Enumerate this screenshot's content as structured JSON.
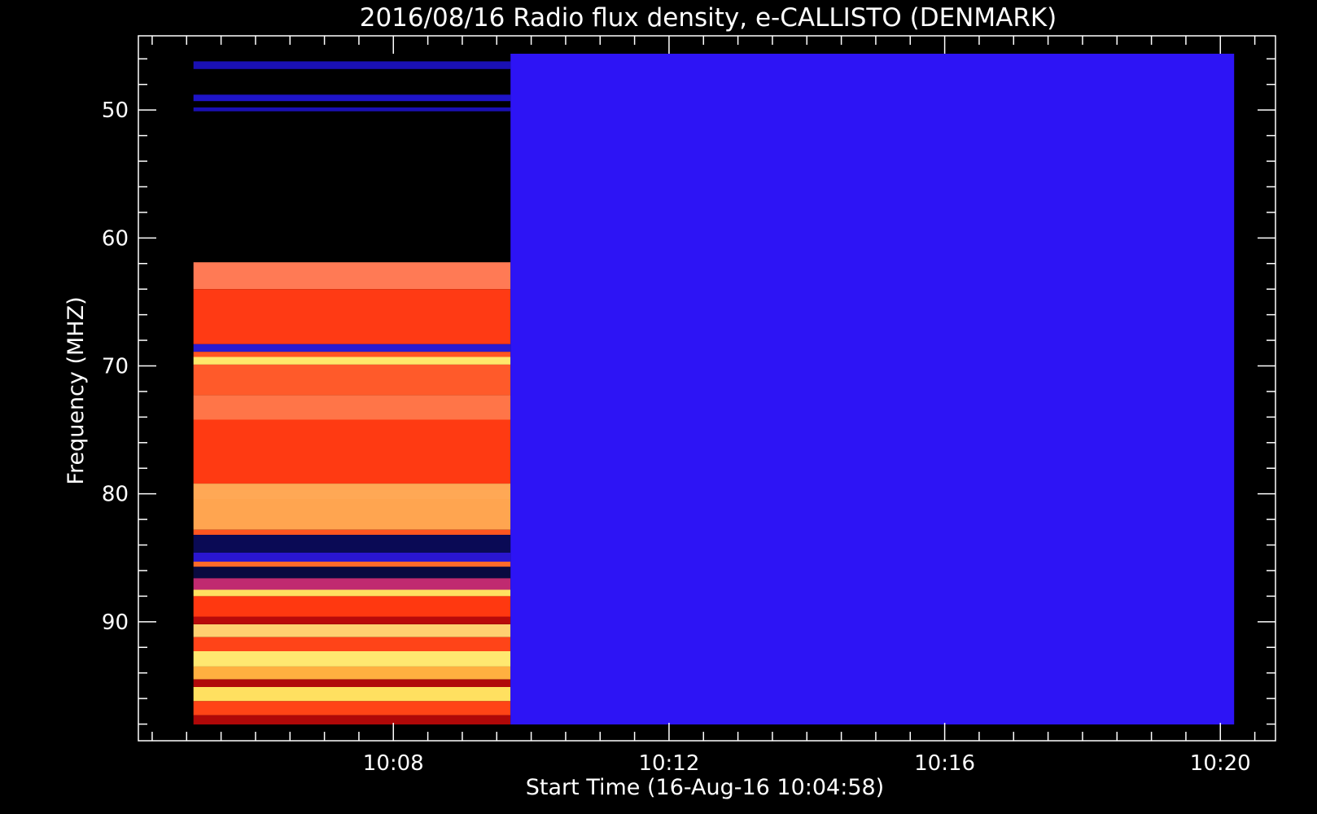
{
  "chart_data": {
    "type": "heatmap",
    "title": "2016/08/16  Radio flux density, e-CALLISTO (DENMARK)",
    "xlabel": "Start Time (16-Aug-16 10:04:58)",
    "ylabel": "Frequency (MHZ)",
    "x_unit": "minutes of day",
    "xlim": [
      604.3,
      620.8
    ],
    "ylim": [
      99.3,
      44.2
    ],
    "y_inverted": true,
    "x_ticks": [
      {
        "value": 608,
        "label": "10:08"
      },
      {
        "value": 612,
        "label": "10:12"
      },
      {
        "value": 616,
        "label": "10:16"
      },
      {
        "value": 620,
        "label": "10:20"
      }
    ],
    "y_ticks": [
      {
        "value": 50,
        "label": "50"
      },
      {
        "value": 60,
        "label": "60"
      },
      {
        "value": 70,
        "label": "70"
      },
      {
        "value": 80,
        "label": "80"
      },
      {
        "value": 90,
        "label": "90"
      }
    ],
    "x_minor_step": 0.5,
    "y_minor_step": 2,
    "segments": [
      {
        "x_range": [
          605.1,
          609.7
        ],
        "freq_range": [
          45.6,
          98.9
        ],
        "bands": [
          {
            "f": [
              46.2,
              46.8
            ],
            "color": "#1a10b4"
          },
          {
            "f": [
              48.8,
              49.3
            ],
            "color": "#1e14c8"
          },
          {
            "f": [
              49.8,
              50.1
            ],
            "color": "#1a10b4"
          },
          {
            "f": [
              61.9,
              64.0
            ],
            "color": "#ff7a55"
          },
          {
            "f": [
              64.0,
              68.3
            ],
            "color": "#ff3a14"
          },
          {
            "f": [
              68.3,
              68.9
            ],
            "color": "#2a1ad0"
          },
          {
            "f": [
              68.9,
              69.3
            ],
            "color": "#ff5522"
          },
          {
            "f": [
              69.3,
              69.9
            ],
            "color": "#ffe86a"
          },
          {
            "f": [
              69.9,
              72.3
            ],
            "color": "#ff5a2a"
          },
          {
            "f": [
              72.3,
              74.2
            ],
            "color": "#ff7548"
          },
          {
            "f": [
              74.2,
              79.2
            ],
            "color": "#ff3a12"
          },
          {
            "f": [
              79.2,
              80.4
            ],
            "color": "#ffa855"
          },
          {
            "f": [
              80.4,
              82.8
            ],
            "color": "#ffa550"
          },
          {
            "f": [
              82.8,
              83.2
            ],
            "color": "#ff5520"
          },
          {
            "f": [
              83.2,
              84.6
            ],
            "color": "#0a0a55"
          },
          {
            "f": [
              84.6,
              85.3
            ],
            "color": "#2a16d0"
          },
          {
            "f": [
              85.3,
              85.7
            ],
            "color": "#ff6a2a"
          },
          {
            "f": [
              85.7,
              86.6
            ],
            "color": "#0a0a40"
          },
          {
            "f": [
              86.6,
              87.5
            ],
            "color": "#c02a70"
          },
          {
            "f": [
              87.5,
              88.0
            ],
            "color": "#ffe060"
          },
          {
            "f": [
              88.0,
              89.6
            ],
            "color": "#ff3810"
          },
          {
            "f": [
              89.6,
              90.2
            ],
            "color": "#b80a0a"
          },
          {
            "f": [
              90.2,
              91.2
            ],
            "color": "#ffd070"
          },
          {
            "f": [
              91.2,
              92.3
            ],
            "color": "#ff4418"
          },
          {
            "f": [
              92.3,
              93.5
            ],
            "color": "#ffe870"
          },
          {
            "f": [
              93.5,
              94.5
            ],
            "color": "#ffb040"
          },
          {
            "f": [
              94.5,
              95.1
            ],
            "color": "#b00a0a"
          },
          {
            "f": [
              95.1,
              96.2
            ],
            "color": "#ffe060"
          },
          {
            "f": [
              96.2,
              97.3
            ],
            "color": "#ff4416"
          },
          {
            "f": [
              97.3,
              98.4
            ],
            "color": "#b00808"
          },
          {
            "f": [
              98.4,
              98.9
            ],
            "color": "#2a16d0"
          }
        ]
      },
      {
        "x_range": [
          609.7,
          620.2
        ],
        "freq_range": [
          45.6,
          100.0
        ],
        "bands": [
          {
            "f": [
              45.6,
              100.0
            ],
            "color": "#2d14f5"
          }
        ]
      }
    ],
    "colors": {
      "background": "#000000",
      "axes": "#ffffff",
      "text": "#ffffff"
    }
  }
}
